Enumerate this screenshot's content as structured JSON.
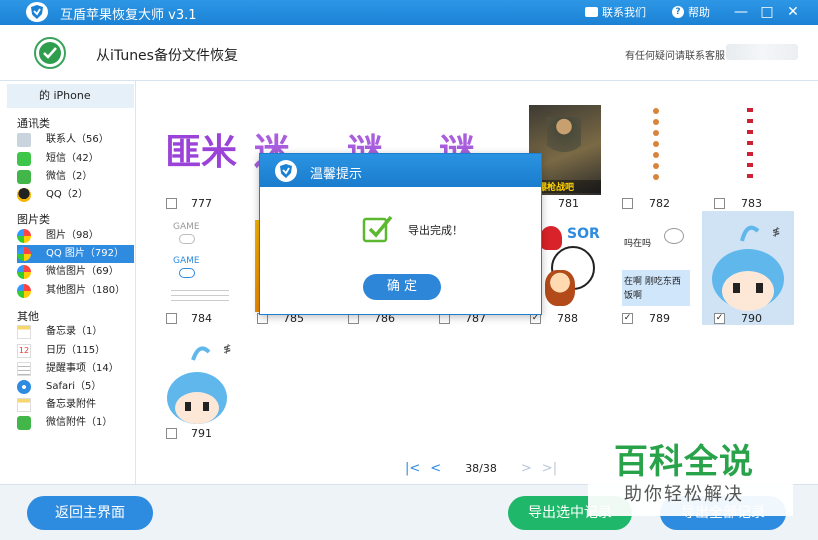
{
  "titlebar": {
    "title": "互盾苹果恢复大师 v3.1",
    "contact": "联系我们",
    "help": "帮助",
    "minimize": "—",
    "maximize": "□",
    "close": "✕"
  },
  "header": {
    "title": "从iTunes备份文件恢复",
    "support": "有任何疑问请联系客服："
  },
  "sidebar": {
    "device": "的 iPhone",
    "categories": [
      {
        "label": "通讯类",
        "items": [
          {
            "label": "联系人（56）",
            "icon": "contacts-icon"
          },
          {
            "label": "短信（42）",
            "icon": "sms-icon"
          },
          {
            "label": "微信（2）",
            "icon": "wechat-icon"
          },
          {
            "label": "QQ（2）",
            "icon": "qq-icon"
          }
        ]
      },
      {
        "label": "图片类",
        "items": [
          {
            "label": "图片（98）",
            "icon": "photos-icon"
          },
          {
            "label": "QQ 图片（792）",
            "icon": "qq-photos-icon",
            "active": true
          },
          {
            "label": "微信图片（69）",
            "icon": "wechat-photos-icon"
          },
          {
            "label": "其他图片（180）",
            "icon": "other-photos-icon"
          }
        ]
      },
      {
        "label": "其他",
        "items": [
          {
            "label": "备忘录（1）",
            "icon": "notes-icon"
          },
          {
            "label": "日历（115）",
            "icon": "calendar-icon"
          },
          {
            "label": "提醒事项（14）",
            "icon": "reminders-icon"
          },
          {
            "label": "Safari（5）",
            "icon": "safari-icon"
          },
          {
            "label": "备忘录附件",
            "icon": "notes-attachment-icon"
          },
          {
            "label": "微信附件（1）",
            "icon": "wechat-attachment-icon"
          }
        ]
      }
    ]
  },
  "thumbs": {
    "row1": [
      {
        "label": "777",
        "text": "匪米",
        "checked": false
      },
      {
        "label": "",
        "text": "迷",
        "checked": false
      },
      {
        "label": "",
        "text": "谜",
        "checked": false
      },
      {
        "label": "",
        "text": "谜",
        "checked": false
      },
      {
        "label": "781",
        "caption": "动爆枪战吧",
        "checked": false
      },
      {
        "label": "782",
        "checked": false
      },
      {
        "label": "783",
        "checked": false
      }
    ],
    "row2": [
      {
        "label": "784",
        "game1": "GAME",
        "game2": "GAME",
        "checked": false
      },
      {
        "label": "785",
        "checked": false
      },
      {
        "label": "786",
        "checked": false
      },
      {
        "label": "787",
        "checked": false
      },
      {
        "label": "788",
        "sorry": "SOR",
        "checked": true
      },
      {
        "label": "789",
        "chat1": "吗在吗",
        "chat2": "在啊  刚吃东西",
        "chat3": "饭啊",
        "checked": true
      },
      {
        "label": "790",
        "checked": true
      }
    ],
    "row3": [
      {
        "label": "791",
        "checked": false
      }
    ]
  },
  "pager": {
    "first": "|<",
    "prev": "<",
    "page": "38/38",
    "next": ">",
    "last": ">|"
  },
  "bottom": {
    "back": "返回主界面",
    "export_selected": "导出选中记录",
    "export_all": "导出全部记录"
  },
  "dialog": {
    "title": "温馨提示",
    "message": "导出完成！",
    "ok": "确 定"
  },
  "watermark": {
    "line1": "百科全说",
    "line2": "助你轻松解决"
  },
  "colors": {
    "primary": "#2d8be0",
    "green_button": "#1fb86a",
    "title_bar": "#1b81d4",
    "watermark_green": "#29a34a"
  }
}
